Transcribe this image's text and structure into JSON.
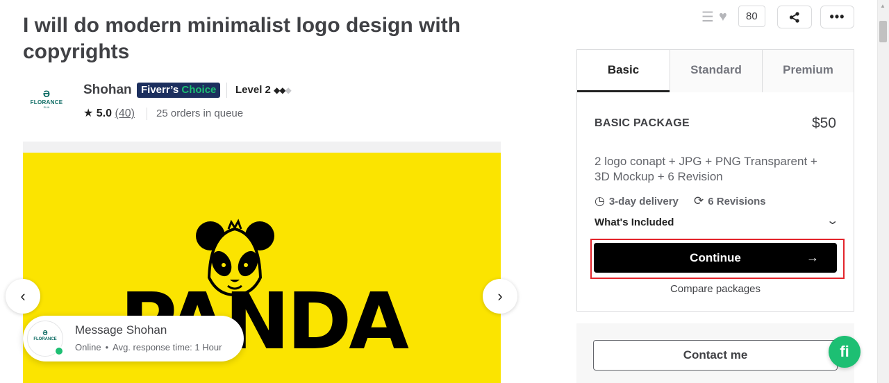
{
  "gig": {
    "title": "I will do modern minimalist logo design with copyrights"
  },
  "seller": {
    "logo_mark": "Ə",
    "logo_brand": "FLORANCE",
    "logo_sub": "ELIA",
    "name": "Shohan",
    "badge_prefix": "Fiverr’s",
    "badge_accent": "Choice",
    "level": "Level 2",
    "level_filled": "◆◆",
    "level_empty": "◆",
    "rating_star": "★",
    "rating": "5.0",
    "reviews": "(40)",
    "queue": "25 orders in queue"
  },
  "gallery": {
    "bg_color": "#fbe400",
    "image_text": "PANDA",
    "prev_icon": "‹",
    "next_icon": "›"
  },
  "message": {
    "title": "Message Shohan",
    "status": "Online",
    "response": "Avg. response time: 1 Hour"
  },
  "topbar": {
    "menu_icon": "☰",
    "heart_icon": "♥",
    "likes": "80",
    "share_icon": "⤴",
    "more_icon": "•••"
  },
  "packages": {
    "tabs": [
      "Basic",
      "Standard",
      "Premium"
    ],
    "name": "BASIC PACKAGE",
    "price": "$50",
    "description": "2 logo conapt + JPG + PNG Transparent + 3D Mockup + 6 Revision",
    "delivery": "3-day delivery",
    "revisions": "6 Revisions",
    "included": "What's Included",
    "continue": "Continue",
    "compare": "Compare packages",
    "contact": "Contact me"
  },
  "chat": {
    "bubble_text": "fi",
    "accent": "#1dbf73"
  }
}
